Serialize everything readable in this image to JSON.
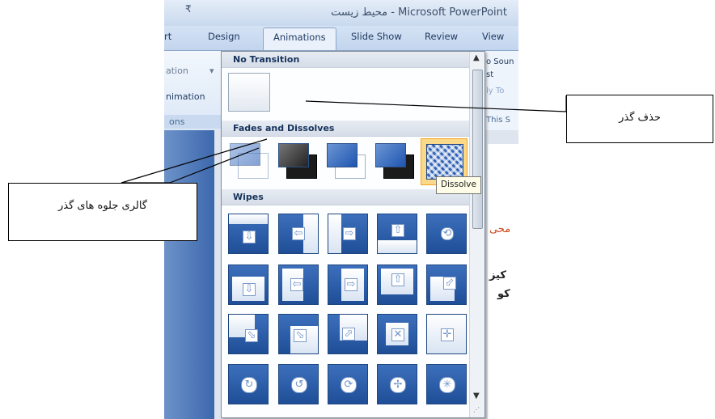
{
  "window": {
    "title": "محیط زیست - Microsoft PowerPoint",
    "quick_access_glyph": "₹"
  },
  "tabs": [
    "rt",
    "Design",
    "Animations",
    "Slide Show",
    "Review",
    "View"
  ],
  "active_tab": "Animations",
  "ribbon": {
    "left_fragments": [
      "ation",
      "nimation",
      "ons"
    ],
    "right_fragments": [
      "o Soun",
      "st",
      "ly To",
      "This S"
    ]
  },
  "slide": {
    "text_fragments": [
      "محی",
      "کیز",
      "کو"
    ]
  },
  "gallery": {
    "sections": {
      "no_transition": "No Transition",
      "fades": "Fades and Dissolves",
      "wipes": "Wipes"
    },
    "selected_item": "Dissolve"
  },
  "tooltip": "Dissolve",
  "callouts": {
    "remove_transition": "حذف گذر",
    "transition_gallery": "گالری جلوه های گذر"
  },
  "colors": {
    "accent": "#1f55b1",
    "selected_border": "#f5a31a"
  }
}
